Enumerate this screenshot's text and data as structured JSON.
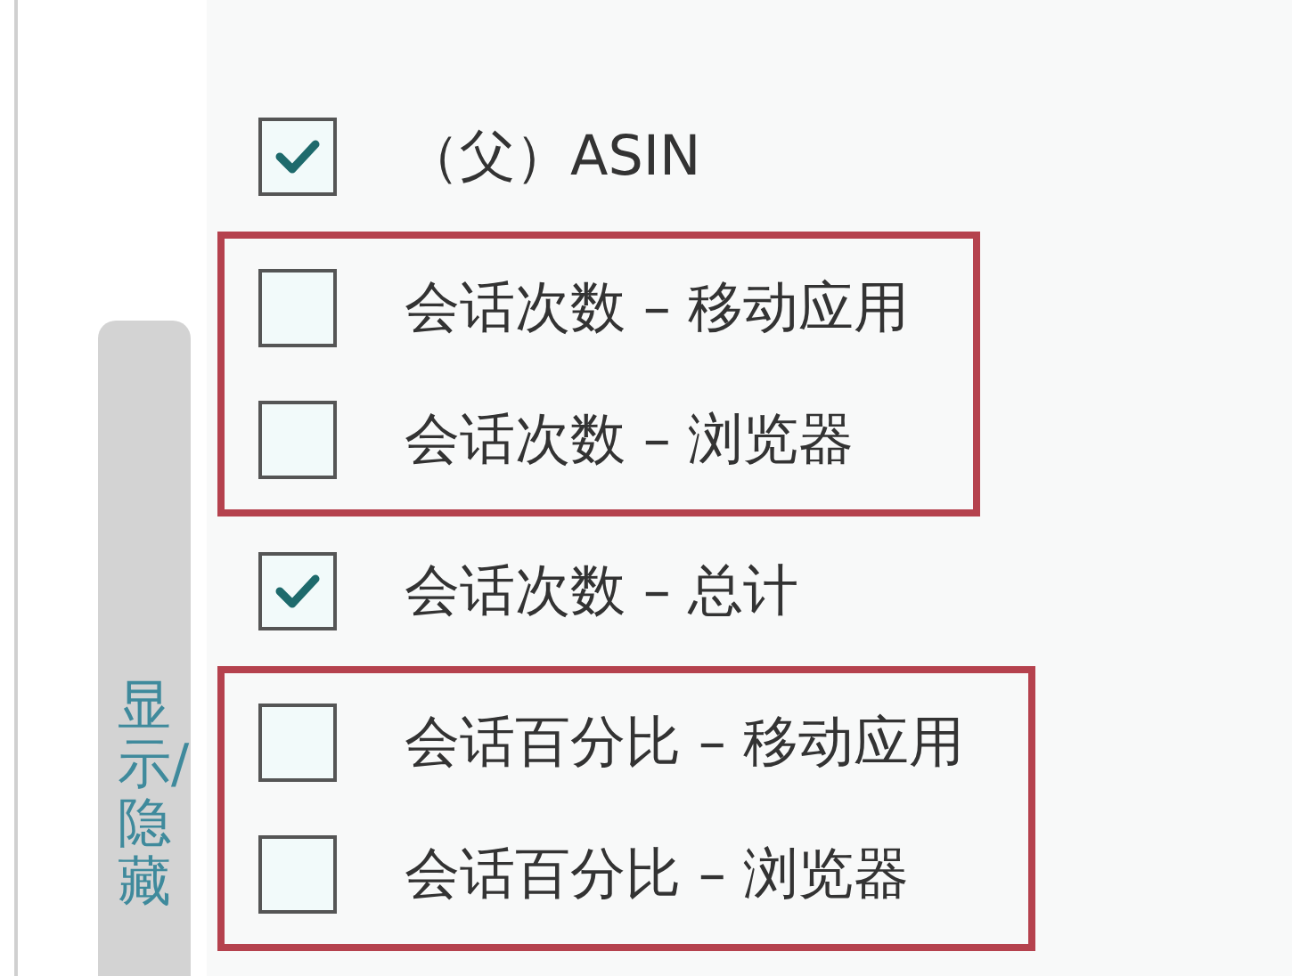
{
  "side_tab": {
    "label": "显示/隐藏"
  },
  "items": [
    {
      "label": "（父）ASIN",
      "checked": true,
      "highlighted": false
    },
    {
      "label": "会话次数 – 移动应用",
      "checked": false,
      "highlighted": true
    },
    {
      "label": "会话次数 – 浏览器",
      "checked": false,
      "highlighted": true
    },
    {
      "label": "会话次数 – 总计",
      "checked": true,
      "highlighted": false
    },
    {
      "label": "会话百分比 – 移动应用",
      "checked": false,
      "highlighted": true
    },
    {
      "label": "会话百分比 – 浏览器",
      "checked": false,
      "highlighted": true
    }
  ]
}
